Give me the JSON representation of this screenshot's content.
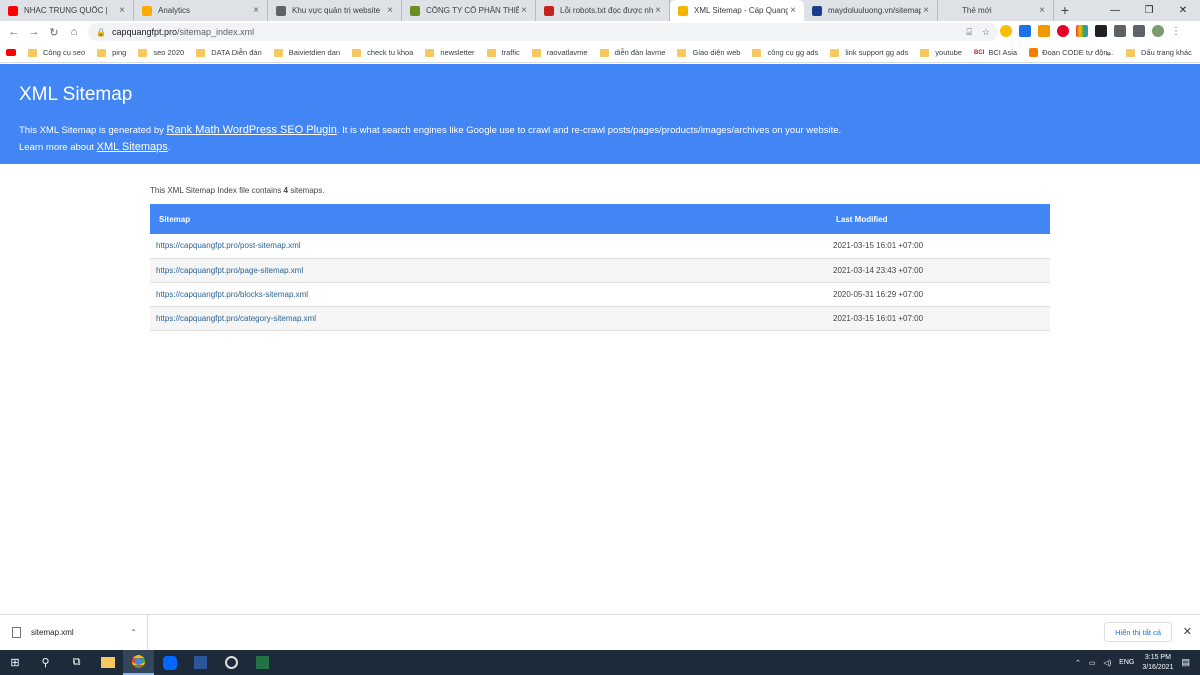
{
  "browser": {
    "tabs": [
      {
        "title": "NHAC TRUNG QUỐC |",
        "favicon_color": "#ff0000"
      },
      {
        "title": "Analytics",
        "favicon_color": "#f9ab00"
      },
      {
        "title": "Khu vực quản trị website",
        "favicon_color": "#5f6368"
      },
      {
        "title": "CÔNG TY CỔ PHẦN THIẾT K",
        "favicon_color": "#6b8e23"
      },
      {
        "title": "Lỗi robots.txt đọc được như",
        "favicon_color": "#c5221f"
      },
      {
        "title": "XML Sitemap - Cáp Quang",
        "favicon_color": "#f4b400"
      },
      {
        "title": "maydoluuluong.vn/sitemap",
        "favicon_color": "#1a3e8c"
      },
      {
        "title": "Thẻ mới",
        "favicon_color": "#dee1e6"
      }
    ],
    "active_tab": 5,
    "new_tab_glyph": "+",
    "window_controls": [
      "—",
      "❐",
      "✕"
    ],
    "url_host": "capquangfpt.pro",
    "url_path": "/sitemap_index.xml",
    "bookmarks": [
      {
        "label": "",
        "type": "youtube"
      },
      {
        "label": "Công cụ seo",
        "type": "folder"
      },
      {
        "label": "ping",
        "type": "folder"
      },
      {
        "label": "seo 2020",
        "type": "folder"
      },
      {
        "label": "DATA Diễn đàn",
        "type": "folder"
      },
      {
        "label": "Baivietdien dan",
        "type": "folder"
      },
      {
        "label": "check tu khoa",
        "type": "folder"
      },
      {
        "label": "newsletter",
        "type": "folder"
      },
      {
        "label": "traffic",
        "type": "folder"
      },
      {
        "label": "raovatlavme",
        "type": "folder"
      },
      {
        "label": "diễn đàn lavme",
        "type": "folder"
      },
      {
        "label": "Giao diện web",
        "type": "folder"
      },
      {
        "label": "công cụ gg ads",
        "type": "folder"
      },
      {
        "label": "link support gg ads",
        "type": "folder"
      },
      {
        "label": "youtube",
        "type": "folder"
      },
      {
        "label": "BCI Asia",
        "type": "bci"
      },
      {
        "label": "Đoạn CODE tự độn...",
        "type": "blogger"
      }
    ],
    "bookmarks_more": "»",
    "other_bookmarks": "Dấu trang khác"
  },
  "page": {
    "header_title": "XML Sitemap",
    "intro_before": "This XML Sitemap is generated by ",
    "intro_link": "Rank Math WordPress SEO Plugin",
    "intro_after": ". It is what search engines like Google use to crawl and re-crawl posts/pages/products/images/archives on your website.",
    "learn_before": "Learn more about ",
    "learn_link": "XML Sitemaps",
    "learn_after": ".",
    "index_before": "This XML Sitemap Index file contains ",
    "index_count": "4",
    "index_after": " sitemaps.",
    "columns": [
      "Sitemap",
      "Last Modified"
    ],
    "rows": [
      {
        "url": "https://capquangfpt.pro/post-sitemap.xml",
        "modified": "2021-03-15 16:01 +07:00"
      },
      {
        "url": "https://capquangfpt.pro/page-sitemap.xml",
        "modified": "2021-03-14 23:43 +07:00"
      },
      {
        "url": "https://capquangfpt.pro/blocks-sitemap.xml",
        "modified": "2020-05-31 16:29 +07:00"
      },
      {
        "url": "https://capquangfpt.pro/category-sitemap.xml",
        "modified": "2021-03-15 16:01 +07:00"
      }
    ],
    "accent_color": "#4285f4"
  },
  "downloads": {
    "file": "sitemap.xml",
    "show_all": "Hiển thị tất cả"
  },
  "taskbar": {
    "lang": "ENG",
    "time": "3:15 PM",
    "date": "3/16/2021"
  }
}
